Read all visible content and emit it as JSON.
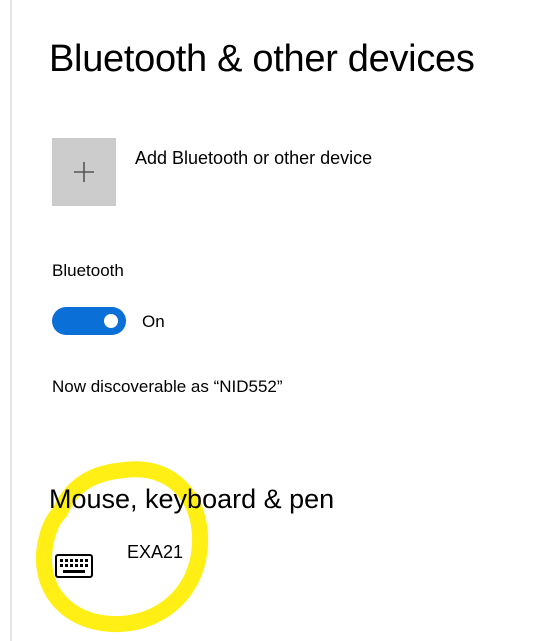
{
  "page": {
    "title": "Bluetooth & other devices"
  },
  "add_device": {
    "label": "Add Bluetooth or other device",
    "icon": "plus-icon"
  },
  "bluetooth": {
    "label": "Bluetooth",
    "toggle_on": true,
    "state_text": "On",
    "accent": "#0a6fd6",
    "discoverable_text": "Now discoverable as “NID552”"
  },
  "mouse_keyboard_pen": {
    "heading": "Mouse, keyboard & pen",
    "devices": [
      {
        "name": "EXA21",
        "icon": "keyboard-icon"
      }
    ]
  },
  "annotation": {
    "color": "#ffee00",
    "shape": "circle-highlight"
  }
}
